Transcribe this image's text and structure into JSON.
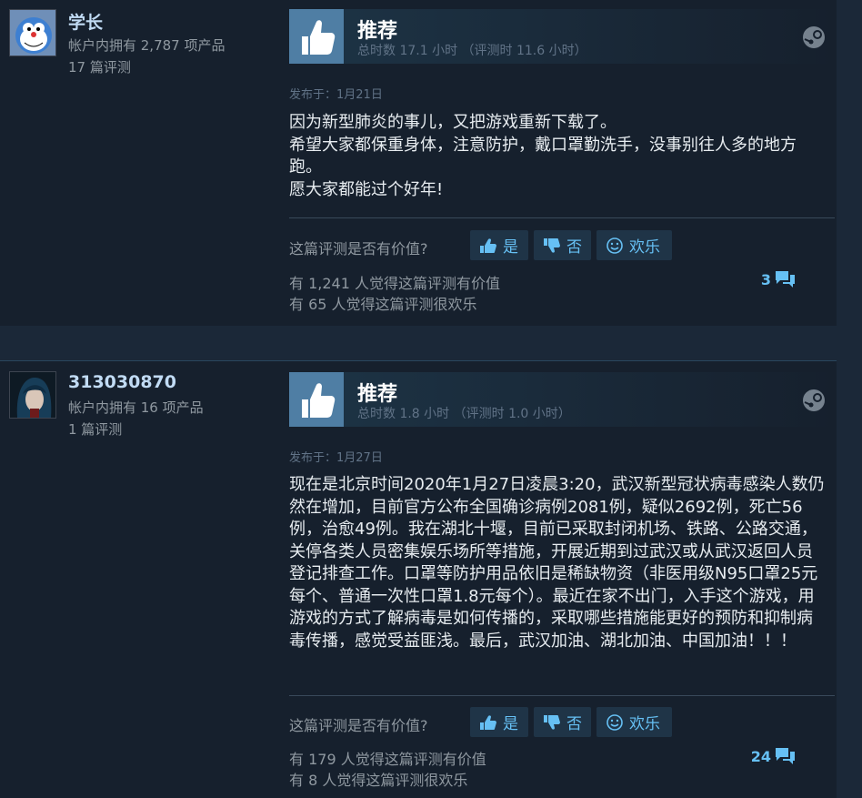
{
  "reviews": [
    {
      "user": {
        "name": "学长",
        "products": "帐户内拥有 2,787 项产品",
        "reviews": "17 篇评测"
      },
      "vote": {
        "title": "推荐",
        "hours": "总时数 17.1 小时 （评测时 11.6 小时）"
      },
      "posted": "发布于：1月21日",
      "content": [
        "因为新型肺炎的事儿，又把游戏重新下载了。",
        "希望大家都保重身体，注意防护，戴口罩勤洗手，没事别往人多的地方跑。",
        "愿大家都能过个好年!"
      ],
      "helpful": {
        "question": "这篇评测是否有价值?",
        "yes": "是",
        "no": "否",
        "funny": "欢乐"
      },
      "stats": {
        "helpful": "有 1,241 人觉得这篇评测有价值",
        "funny": "有 65 人觉得这篇评测很欢乐"
      },
      "comments": "3"
    },
    {
      "user": {
        "name": "313030870",
        "products": "帐户内拥有 16 项产品",
        "reviews": "1 篇评测"
      },
      "vote": {
        "title": "推荐",
        "hours": "总时数 1.8 小时 （评测时 1.0 小时）"
      },
      "posted": "发布于：1月27日",
      "content": [
        "现在是北京时间2020年1月27日凌晨3:20，武汉新型冠状病毒感染人数仍然在增加，目前官方公布全国确诊病例2081例，疑似2692例，死亡56例，治愈49例。我在湖北十堰，目前已采取封闭机场、铁路、公路交通，关停各类人员密集娱乐场所等措施，开展近期到过武汉或从武汉返回人员登记排查工作。口罩等防护用品依旧是稀缺物资（非医用级N95口罩25元每个、普通一次性口罩1.8元每个）。最近在家不出门，入手这个游戏，用游戏的方式了解病毒是如何传播的，采取哪些措施能更好的预防和抑制病毒传播，感觉受益匪浅。最后，武汉加油、湖北加油、中国加油！！！"
      ],
      "helpful": {
        "question": "这篇评测是否有价值?",
        "yes": "是",
        "no": "否",
        "funny": "欢乐"
      },
      "stats": {
        "helpful": "有 179 人觉得这篇评测有价值",
        "funny": "有 8 人觉得这篇评测很欢乐"
      },
      "comments": "24"
    }
  ],
  "icons": {
    "thumb": "thumbs-up-icon",
    "steam": "steam-logo-icon",
    "comment": "comment-bubble-icon",
    "smile": "smile-icon"
  },
  "colors": {
    "accent": "#66c0f4",
    "thumb_bg": "#4f7ea4",
    "panel": "#16202d",
    "page": "#1b2838"
  }
}
